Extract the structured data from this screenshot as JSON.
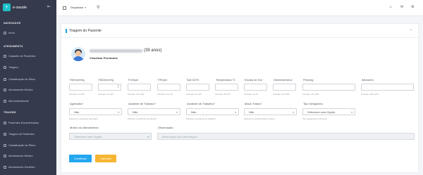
{
  "app": {
    "name": "e-saude",
    "logo_glyph": "+"
  },
  "sidebar": {
    "sections": [
      {
        "title": "NAVEGADOR",
        "items": [
          {
            "label": "Início"
          }
        ]
      },
      {
        "title": "ATENDIMENTO",
        "items": [
          {
            "label": "Cadastro de Pacientes"
          },
          {
            "label": "Triagem"
          },
          {
            "label": "Classificação de Risco"
          },
          {
            "label": "Atendimento Médico"
          },
          {
            "label": "Alta Ambulatorial"
          }
        ]
      },
      {
        "title": "TRIAGEM",
        "items": [
          {
            "label": "Pacientes Encaminhados"
          },
          {
            "label": "Triagem de Pacientes"
          },
          {
            "label": "Classificação de Risco"
          },
          {
            "label": "Atendimento Médico"
          },
          {
            "label": "Atendimento Genético"
          }
        ]
      }
    ]
  },
  "topbar": {
    "dropdown_value": "Dropdown",
    "icons": [
      "expand-icon",
      "search-icon",
      "bell-icon",
      "mail-icon",
      "user-icon"
    ]
  },
  "card": {
    "title": "Triagem do Paciente",
    "menu": "..."
  },
  "patient": {
    "age": "(39 anos)",
    "view_link": "Visualizar Prontuario"
  },
  "vitals": [
    {
      "label": "PAS/mmHg",
      "hint": "Intervalo: 0 a 250"
    },
    {
      "label": "PAD/mmHg",
      "hint": "Intervalo: 0 a 150"
    },
    {
      "label": "FC/bpm",
      "hint": "Intervalo: 30 a 240"
    },
    {
      "label": "FR/rpm",
      "hint": "Intervalo: 10 a 40"
    },
    {
      "label": "Sat O2/%",
      "hint": "Intervalo: 0 a 100"
    },
    {
      "label": "Temperatura °C",
      "hint": "Intervalo: 30 a 45"
    },
    {
      "label": "Escala de Dor",
      "hint": "Intervalo: 0 a 10"
    },
    {
      "label": "Glicemia/mmol",
      "hint": "Intervalo: 20 a 600"
    },
    {
      "label": "Peso/kg",
      "hint": "Intervalo: 10 a 250"
    },
    {
      "label": "Altura/cm",
      "hint": "Intervalo: 100 a 270"
    }
  ],
  "questions": [
    {
      "label": "Agressão?",
      "value": "Não",
      "hint": "Paciente ou agressão agressão?"
    },
    {
      "label": "Acidente de Trânsito?",
      "value": "Não",
      "hint": "Paciente ou acidente de trânsito?"
    },
    {
      "label": "Acidente de Trabalho?",
      "value": "Não",
      "hint": "Paciente ou acidente de trabalho?"
    },
    {
      "label": "Maus Tratos?",
      "value": "Não",
      "hint": "Paciente ou acidente Maus Tratos?"
    },
    {
      "label": "Tipo Seeguiheo",
      "value": "Selecione uma Opção",
      "hint": "Tipo Seeguiheo do Paciente"
    }
  ],
  "motivo": {
    "label": "Motivo do Atendimento",
    "placeholder": "Selecione uma Opção"
  },
  "observacao": {
    "label": "Observação",
    "placeholder": "Observação da Enfermagem"
  },
  "buttons": {
    "confirm": "Confirmar",
    "cancel": "Cancelar"
  },
  "colors": {
    "sidebar": "#353b4d",
    "accent": "#1aa3d6",
    "confirm": "#24a7ef",
    "cancel": "#f6b631",
    "logo": "#1ec0c8"
  }
}
